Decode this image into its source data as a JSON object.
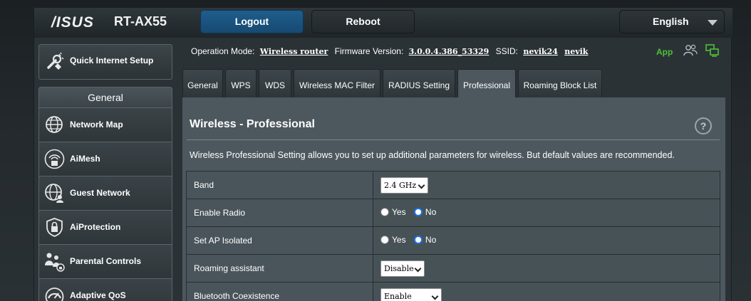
{
  "header": {
    "brand": "/ISUS",
    "model": "RT-AX55",
    "logout_label": "Logout",
    "reboot_label": "Reboot",
    "language": "English"
  },
  "status": {
    "op_mode_label": "Operation Mode:",
    "op_mode_value": "Wireless router",
    "fw_label": "Firmware Version:",
    "fw_value": "3.0.0.4.386_53329",
    "ssid_label": "SSID:",
    "ssid_1": "nevik24",
    "ssid_2": "nevik",
    "app_label": "App"
  },
  "sidebar": {
    "qis_label": "Quick Internet Setup",
    "section_title": "General",
    "items": [
      {
        "label": "Network Map",
        "icon": "globe-network-icon"
      },
      {
        "label": "AiMesh",
        "icon": "aimesh-icon"
      },
      {
        "label": "Guest Network",
        "icon": "guest-network-icon"
      },
      {
        "label": "AiProtection",
        "icon": "lock-shield-icon"
      },
      {
        "label": "Parental Controls",
        "icon": "family-icon"
      },
      {
        "label": "Adaptive QoS",
        "icon": "speedometer-icon"
      }
    ]
  },
  "tabs": [
    {
      "label": "General"
    },
    {
      "label": "WPS"
    },
    {
      "label": "WDS"
    },
    {
      "label": "Wireless MAC Filter"
    },
    {
      "label": "RADIUS Setting"
    },
    {
      "label": "Professional"
    },
    {
      "label": "Roaming Block List"
    }
  ],
  "content": {
    "title": "Wireless - Professional",
    "help": "?",
    "description": "Wireless Professional Setting allows you to set up additional parameters for wireless. But default values are recommended.",
    "rows": [
      {
        "label": "Band",
        "type": "select",
        "value": "2.4 GHz"
      },
      {
        "label": "Enable Radio",
        "type": "radio",
        "yes": "Yes",
        "no": "No",
        "selected": "No"
      },
      {
        "label": "Set AP Isolated",
        "type": "radio",
        "yes": "Yes",
        "no": "No",
        "selected": "No"
      },
      {
        "label": "Roaming assistant",
        "type": "select",
        "value": "Disable"
      },
      {
        "label": "Bluetooth Coexistence",
        "type": "select",
        "value": "Enable"
      }
    ]
  },
  "colors": {
    "logout_bg": "#1f5d8c",
    "app_link": "#4fc034",
    "radio_selected": "#1a73e8"
  }
}
